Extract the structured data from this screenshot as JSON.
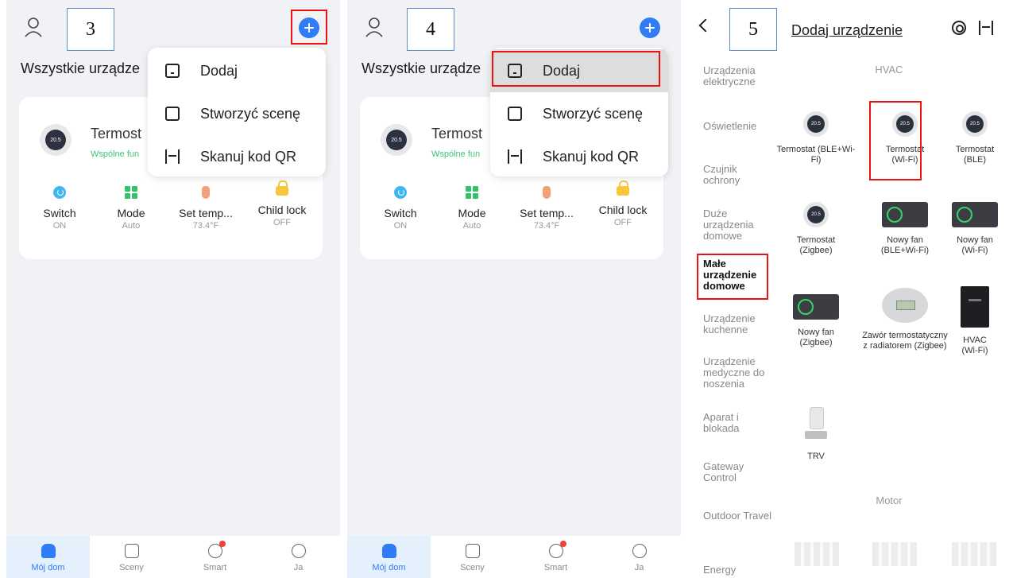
{
  "panel3": {
    "step": "3",
    "home_title": "Wszystkie urządze",
    "device": {
      "name": "Termost",
      "sub": "Wspólne fun",
      "display": "20.5"
    },
    "controls": [
      {
        "label": "Switch",
        "value": "ON"
      },
      {
        "label": "Mode",
        "value": "Auto"
      },
      {
        "label": "Set temp...",
        "value": "73.4°F"
      },
      {
        "label": "Child lock",
        "value": "OFF"
      }
    ],
    "menu": [
      "Dodaj",
      "Stworzyć scenę",
      "Skanuj kod QR"
    ],
    "tabs": [
      "Mój dom",
      "Sceny",
      "Smart",
      "Ja"
    ]
  },
  "panel4": {
    "step": "4",
    "home_title": "Wszystkie urządze",
    "device": {
      "name": "Termost",
      "sub": "Wspólne fun",
      "display": "20.5"
    },
    "controls": [
      {
        "label": "Switch",
        "value": "ON"
      },
      {
        "label": "Mode",
        "value": "Auto"
      },
      {
        "label": "Set temp...",
        "value": "73.4°F"
      },
      {
        "label": "Child lock",
        "value": "OFF"
      }
    ],
    "menu": [
      "Dodaj",
      "Stworzyć scenę",
      "Skanuj kod QR"
    ],
    "tabs": [
      "Mój dom",
      "Sceny",
      "Smart",
      "Ja"
    ]
  },
  "panel5": {
    "step": "5",
    "title": "Dodaj urządzenie",
    "categories": [
      "Urządzenia elektryczne",
      "Oświetlenie",
      "Czujnik ochrony",
      "Duże urządzenia domowe",
      "Małe urządzenie domowe",
      "Urządzenie kuchenne",
      "Urządzenie medyczne do noszenia",
      "Aparat i blokada",
      "Gateway Control",
      "Outdoor Travel",
      "Energy"
    ],
    "sections": [
      "HVAC",
      "Motor"
    ],
    "thermo_display": "20.5",
    "devices": [
      "Termostat (BLE+Wi-Fi)",
      "Termostat (Wi-Fi)",
      "Termostat (BLE)",
      "Termostat (Zigbee)",
      "Nowy fan (BLE+Wi-Fi)",
      "Nowy fan (Wi-Fi)",
      "Nowy fan (Zigbee)",
      "Zawór termostatyczny z radiatorem (Zigbee)",
      "HVAC (Wi-Fi)",
      "TRV"
    ]
  },
  "colors": {
    "accent": "#2f7cf6",
    "highlight": "#e11111",
    "green": "#3cc37a"
  }
}
